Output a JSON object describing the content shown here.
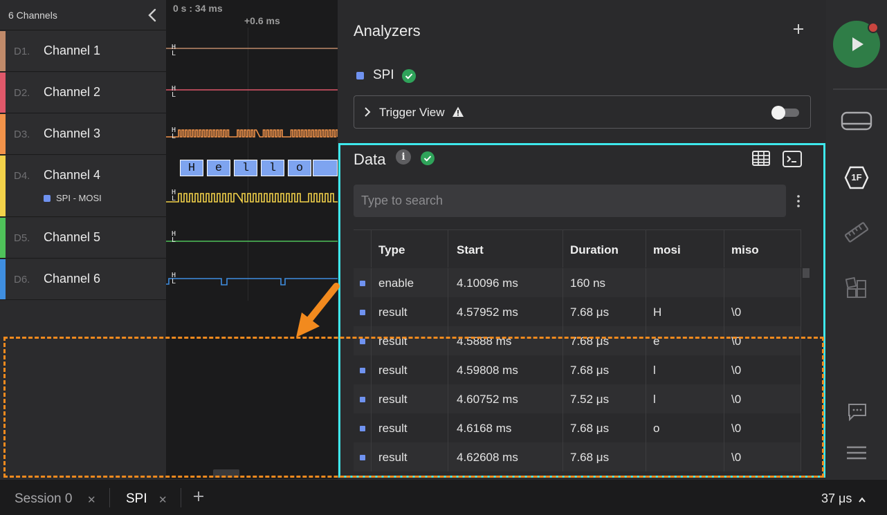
{
  "channels_header": {
    "title": "6 Channels",
    "collapse_icon": "chevron-left-icon"
  },
  "channels": [
    {
      "id": "D1.",
      "name": "Channel 1",
      "color": "#c08a6a",
      "hl": "H\nL"
    },
    {
      "id": "D2.",
      "name": "Channel 2",
      "color": "#e0586a",
      "hl": "H\nL"
    },
    {
      "id": "D3.",
      "name": "Channel 3",
      "color": "#f2934a",
      "hl": "H\nL"
    },
    {
      "id": "D4.",
      "name": "Channel 4",
      "color": "#f3d24a",
      "hl": "H\nL",
      "sub": "SPI - MOSI"
    },
    {
      "id": "D5.",
      "name": "Channel 5",
      "color": "#4fc25a",
      "hl": "H\nL"
    },
    {
      "id": "D6.",
      "name": "Channel 6",
      "color": "#3f8ee0",
      "hl": "H\nL"
    }
  ],
  "timeline": {
    "start": "0 s : 34 ms",
    "offset": "+0.6 ms"
  },
  "decoded_bytes": [
    "H",
    "e",
    "l",
    "l",
    "o",
    ""
  ],
  "analyzers": {
    "title": "Analyzers",
    "add_icon": "plus-icon",
    "items": [
      {
        "name": "SPI",
        "status_icon": "check-circle-icon",
        "color": "#6f92f0"
      }
    ],
    "trigger_view": {
      "label": "Trigger View",
      "warning_icon": "warning-icon",
      "enabled": false
    }
  },
  "data": {
    "title": "Data",
    "search_placeholder": "Type to search",
    "columns": [
      "Type",
      "Start",
      "Duration",
      "mosi",
      "miso"
    ],
    "rows": [
      [
        "enable",
        "4.10096 ms",
        "160 ns",
        "",
        ""
      ],
      [
        "result",
        "4.57952 ms",
        "7.68 μs",
        "H",
        "\\0"
      ],
      [
        "result",
        "4.5888 ms",
        "7.68 μs",
        "e",
        "\\0"
      ],
      [
        "result",
        "4.59808 ms",
        "7.68 μs",
        "l",
        "\\0"
      ],
      [
        "result",
        "4.60752 ms",
        "7.52 μs",
        "l",
        "\\0"
      ],
      [
        "result",
        "4.6168 ms",
        "7.68 μs",
        "o",
        "\\0"
      ],
      [
        "result",
        "4.62608 ms",
        "7.68 μs",
        "",
        "\\0"
      ]
    ]
  },
  "toolbar": {
    "run_icon": "play-icon",
    "icons": [
      "device-icon",
      "hex-1f-icon",
      "ruler-icon",
      "extensions-icon",
      "chat-icon",
      "menu-icon"
    ],
    "hex_label": "1F"
  },
  "bottom_bar": {
    "tabs": [
      {
        "label": "Session 0",
        "active": false
      },
      {
        "label": "SPI",
        "active": true
      }
    ],
    "add_tab_icon": "plus-icon",
    "time_per_div": "37 μs"
  },
  "colors": {
    "accent_cyan": "#3ee8ec",
    "annotation_orange": "#f28a1e",
    "run_green": "#2f7d47"
  }
}
